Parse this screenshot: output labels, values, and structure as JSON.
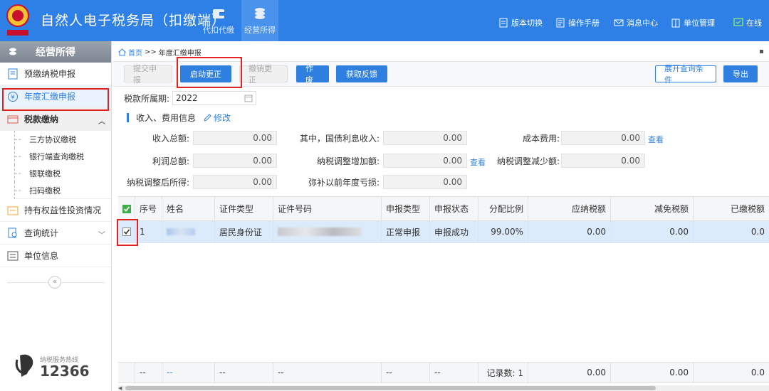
{
  "header": {
    "title": "自然人电子税务局（扣缴端）",
    "tabs": [
      {
        "label": "代扣代缴",
        "icon": "wallet-icon"
      },
      {
        "label": "经营所得",
        "icon": "coins-icon"
      }
    ],
    "right_menu": [
      {
        "label": "版本切换",
        "icon": "document-icon"
      },
      {
        "label": "操作手册",
        "icon": "book-icon"
      },
      {
        "label": "消息中心",
        "icon": "mail-icon"
      },
      {
        "label": "单位管理",
        "icon": "building-icon"
      },
      {
        "label": "在线",
        "icon": "online-icon"
      }
    ]
  },
  "sidebar": {
    "title": "经营所得",
    "items": [
      {
        "label": "预缴纳税申报"
      },
      {
        "label": "年度汇缴申报"
      },
      {
        "label": "税款缴纳"
      },
      {
        "label": "持有权益性投资情况"
      },
      {
        "label": "查询统计"
      },
      {
        "label": "单位信息"
      }
    ],
    "sub_items": [
      "三方协议缴税",
      "银行端查询缴税",
      "银联缴税",
      "扫码缴税"
    ],
    "collapse_glyph": "«",
    "hotline_label": "纳税服务热线",
    "hotline_number": "12366"
  },
  "breadcrumb": {
    "home": "首页",
    "sep": ">>",
    "current": "年度汇缴申报"
  },
  "toolbar": {
    "submit": "提交申报",
    "start_correction": "启动更正",
    "cancel_correction": "撤销更正",
    "void": "作废",
    "get_feedback": "获取反馈",
    "expand_query": "展开查询条件",
    "export": "导出"
  },
  "period": {
    "label": "税款所属期:",
    "value": "2022"
  },
  "section": {
    "title": "收入、费用信息",
    "edit": "修改"
  },
  "fields": {
    "total_income": {
      "label": "收入总额:",
      "value": "0.00"
    },
    "bond_interest": {
      "label": "其中，国债利息收入:",
      "value": "0.00"
    },
    "cost": {
      "label": "成本费用:",
      "value": "0.00"
    },
    "total_profit": {
      "label": "利润总额:",
      "value": "0.00"
    },
    "adj_increase": {
      "label": "纳税调整增加额:",
      "value": "0.00"
    },
    "adj_decrease": {
      "label": "纳税调整减少额:",
      "value": "0.00"
    },
    "adjusted_income": {
      "label": "纳税调整后所得:",
      "value": "0.00"
    },
    "loss_offset": {
      "label": "弥补以前年度亏损:",
      "value": "0.00"
    },
    "view": "查看"
  },
  "table": {
    "headers": [
      "序号",
      "姓名",
      "证件类型",
      "证件号码",
      "申报类型",
      "申报状态",
      "分配比例",
      "应纳税额",
      "减免税额",
      "已缴税额"
    ],
    "row": {
      "seq": "1",
      "id_type": "居民身份证",
      "report_type": "正常申报",
      "status": "申报成功",
      "ratio": "99.00%",
      "tax_payable": "0.00",
      "tax_reduction": "0.00",
      "tax_paid": "0.0"
    },
    "footer": {
      "dash": "--",
      "records": "记录数: 1",
      "tax_payable": "0.00",
      "tax_reduction": "0.00",
      "tax_paid": "0.0"
    }
  },
  "colors": {
    "brand": "#2f80e6",
    "highlight": "#e32222",
    "selected_row": "#dcebfb"
  }
}
